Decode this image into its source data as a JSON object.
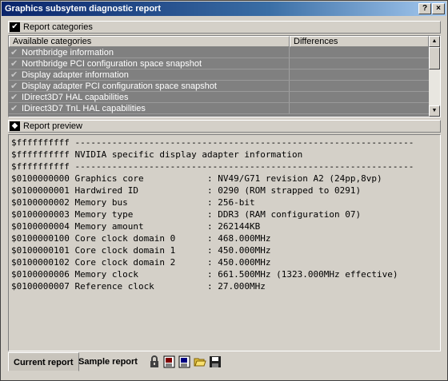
{
  "window": {
    "title": "Graphics subsytem diagnostic report",
    "help_label": "?",
    "close_label": "×"
  },
  "categories_section": {
    "label": "Report categories",
    "columns": [
      "Available categories",
      "Differences"
    ],
    "items": [
      "Northbridge information",
      "Northbridge PCI configuration space snapshot",
      "Display adapter information",
      "Display adapter PCI configuration space snapshot",
      "IDirect3D7 HAL capabilities",
      "IDirect3D7 TnL HAL capabilities"
    ]
  },
  "preview_section": {
    "label": "Report preview",
    "lines": [
      "$ffffffffff ----------------------------------------------------------------",
      "$ffffffffff NVIDIA specific display adapter information",
      "$ffffffffff ----------------------------------------------------------------",
      "$0100000000 Graphics core            : NV49/G71 revision A2 (24pp,8vp)",
      "$0100000001 Hardwired ID             : 0290 (ROM strapped to 0291)",
      "$0100000002 Memory bus               : 256-bit",
      "$0100000003 Memory type              : DDR3 (RAM configuration 07)",
      "$0100000004 Memory amount            : 262144KB",
      "$0100000100 Core clock domain 0      : 468.000MHz",
      "$0100000101 Core clock domain 1      : 450.000MHz",
      "$0100000102 Core clock domain 2      : 450.000MHz",
      "$0100000006 Memory clock             : 661.500MHz (1323.000MHz effective)",
      "$0100000007 Reference clock          : 27.000MHz"
    ]
  },
  "tabs": {
    "current": "Current report",
    "sample": "Sample report"
  },
  "toolbar": [
    "lock-icon",
    "report-view-icon",
    "report-compare-icon",
    "open-folder-icon",
    "save-disk-icon"
  ],
  "colors": {
    "titlebar_start": "#0a246a",
    "titlebar_end": "#a6caf0",
    "face": "#d4d0c8",
    "list_background": "#808080"
  }
}
